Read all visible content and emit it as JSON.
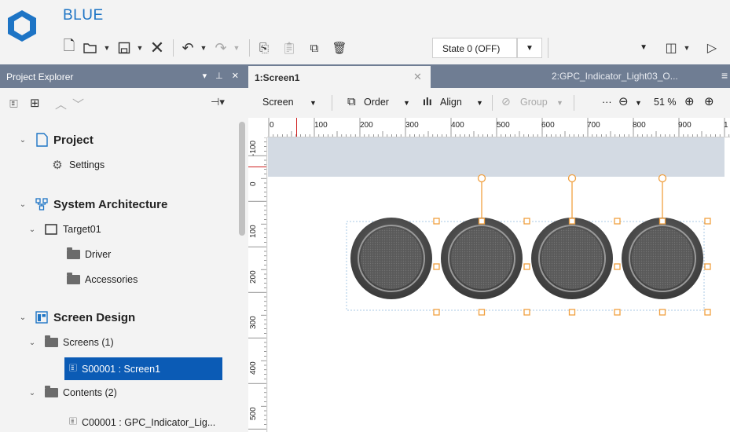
{
  "app": {
    "title": "BLUE"
  },
  "toolbar": {
    "icons": [
      "new-file-icon",
      "open-folder-icon",
      "save-icon",
      "delete-icon",
      "undo-icon",
      "redo-icon",
      "copy-icon",
      "paste-icon",
      "duplicate-icon",
      "trash-icon"
    ],
    "state_value": "State 0 (OFF)"
  },
  "project_explorer": {
    "title": "Project Explorer",
    "header_controls": "▾ ⊥ ✕",
    "tree": {
      "project": "Project",
      "settings": "Settings",
      "system_architecture": "System Architecture",
      "target": "Target01",
      "driver": "Driver",
      "accessories": "Accessories",
      "screen_design": "Screen Design",
      "screens": "Screens (1)",
      "screen1": "S00001 : Screen1",
      "contents": "Contents (2)",
      "content1": "C00001 : GPC_Indicator_Lig..."
    }
  },
  "document": {
    "active_tab": "1:Screen1",
    "inactive_tab": "2:GPC_Indicator_Light03_O...",
    "toolbar": {
      "screen": "Screen",
      "order": "Order",
      "align": "Align",
      "group": "Group",
      "more": "···",
      "zoom": "51 %"
    },
    "ruler_h": [
      "0",
      "100",
      "200",
      "300",
      "400",
      "500",
      "600",
      "700",
      "800",
      "900",
      "1"
    ],
    "ruler_v": [
      "-100",
      "0",
      "100",
      "200",
      "300",
      "400",
      "500"
    ]
  },
  "colors": {
    "accent": "#1d74c5",
    "panel_header": "#6f7d93",
    "selection": "#0b5bb5",
    "handle": "#f0a040"
  }
}
